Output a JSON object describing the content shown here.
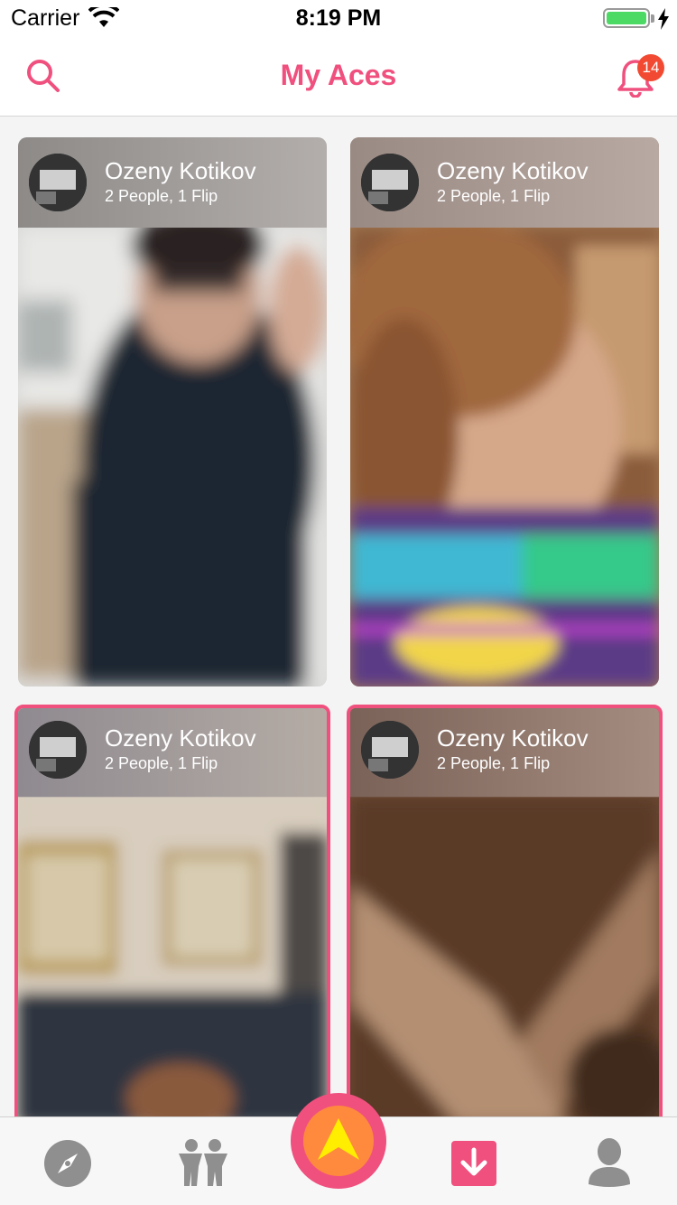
{
  "status_bar": {
    "carrier": "Carrier",
    "time": "8:19 PM",
    "battery_level": 1.0
  },
  "nav": {
    "title": "My Aces",
    "notification_count": "14",
    "left_icon": "search-icon",
    "right_icon": "bell-icon"
  },
  "cards": [
    {
      "name": "Ozeny Kotikov",
      "subtitle": "2 People, 1 Flip",
      "selected": false
    },
    {
      "name": "Ozeny Kotikov",
      "subtitle": "2 People, 1 Flip",
      "selected": false
    },
    {
      "name": "Ozeny Kotikov",
      "subtitle": "2 People, 1 Flip",
      "selected": true
    },
    {
      "name": "Ozeny Kotikov",
      "subtitle": "2 People, 1 Flip",
      "selected": true
    }
  ],
  "tab_bar": {
    "items": [
      {
        "icon": "compass-icon",
        "active": false
      },
      {
        "icon": "people-icon",
        "active": false
      },
      {
        "icon": "ace-arrow-icon",
        "active": false
      },
      {
        "icon": "download-icon",
        "active": true
      },
      {
        "icon": "profile-icon",
        "active": false
      }
    ]
  },
  "colors": {
    "accent": "#f0507e",
    "badge": "#f24a32",
    "center_button": "#ff8a3d",
    "center_arrow": "#ffee00",
    "tab_inactive": "#8f8f8f"
  }
}
